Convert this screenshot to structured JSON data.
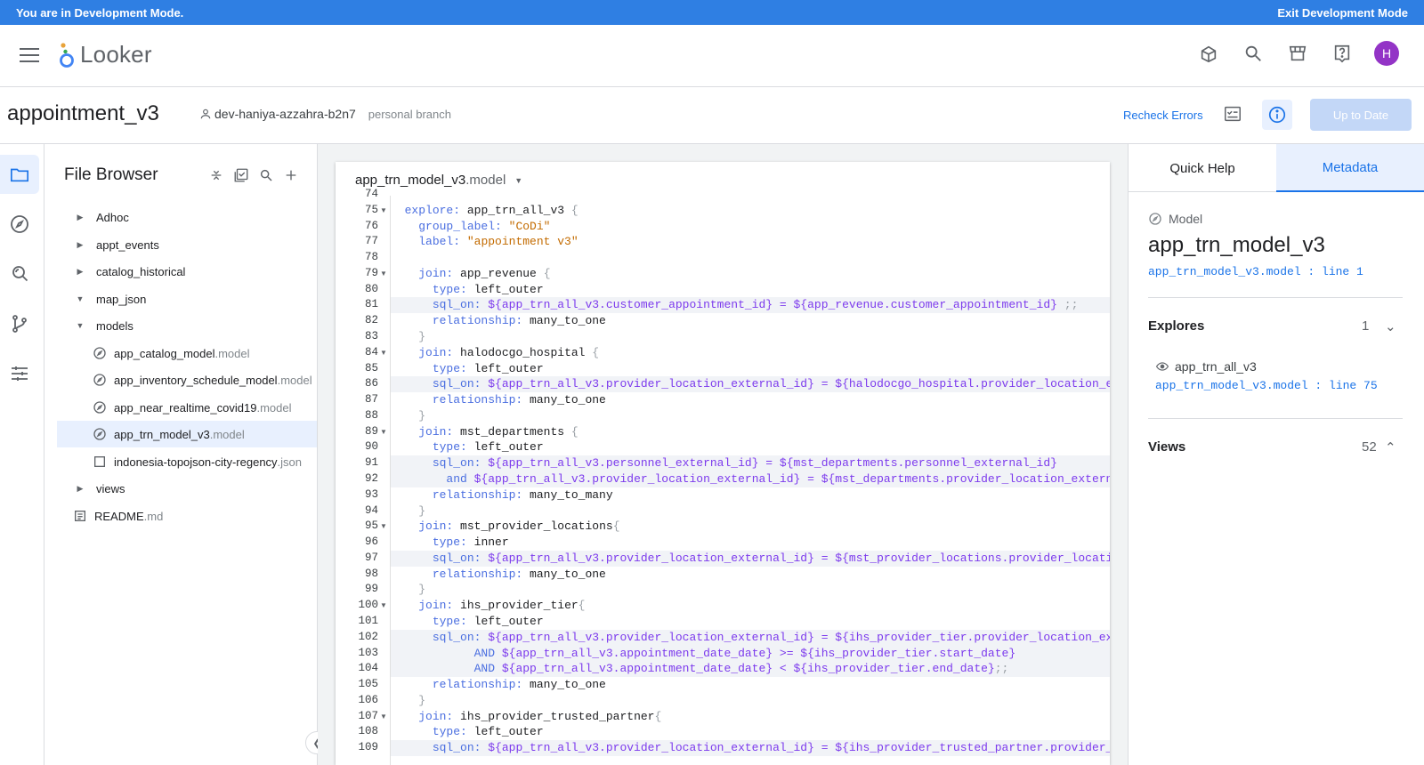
{
  "devbar": {
    "message": "You are in Development Mode.",
    "exit_label": "Exit Development Mode"
  },
  "topnav": {
    "logo_text": "Looker",
    "avatar_letter": "H"
  },
  "project": {
    "title": "appointment_v3",
    "branch": "dev-haniya-azzahra-b2n7",
    "branch_type": "personal branch",
    "recheck_label": "Recheck Errors",
    "uptodate_label": "Up to Date"
  },
  "filebrowser": {
    "title": "File Browser",
    "items": [
      {
        "name": "Adhoc",
        "ext": ""
      },
      {
        "name": "appt_events",
        "ext": ""
      },
      {
        "name": "catalog_historical",
        "ext": ""
      },
      {
        "name": "map_json",
        "ext": ""
      },
      {
        "name": "models",
        "ext": ""
      },
      {
        "name": "app_catalog_model",
        "ext": ".model"
      },
      {
        "name": "app_inventory_schedule_model",
        "ext": ".model"
      },
      {
        "name": "app_near_realtime_covid19",
        "ext": ".model"
      },
      {
        "name": "app_trn_model_v3",
        "ext": ".model"
      },
      {
        "name": "indonesia-topojson-city-regency",
        "ext": ".json"
      },
      {
        "name": "views",
        "ext": ""
      },
      {
        "name": "README",
        "ext": ".md"
      }
    ]
  },
  "editor": {
    "tab_name": "app_trn_model_v3",
    "tab_ext": ".model",
    "line_numbers": [
      "74",
      "75",
      "76",
      "77",
      "78",
      "79",
      "80",
      "81",
      "82",
      "83",
      "84",
      "85",
      "86",
      "87",
      "88",
      "89",
      "90",
      "91",
      "92",
      "93",
      "94",
      "95",
      "96",
      "97",
      "98",
      "99",
      "100",
      "101",
      "102",
      "103",
      "104",
      "105",
      "106",
      "107",
      "108",
      "109"
    ]
  },
  "metadata": {
    "tabs": {
      "quick_help": "Quick Help",
      "metadata": "Metadata"
    },
    "type_label": "Model",
    "model_name": "app_trn_model_v3",
    "model_link": "app_trn_model_v3.model : line 1",
    "explores_label": "Explores",
    "explores_count": "1",
    "explore_name": "app_trn_all_v3",
    "explore_link": "app_trn_model_v3.model : line 75",
    "views_label": "Views",
    "views_count": "52"
  }
}
